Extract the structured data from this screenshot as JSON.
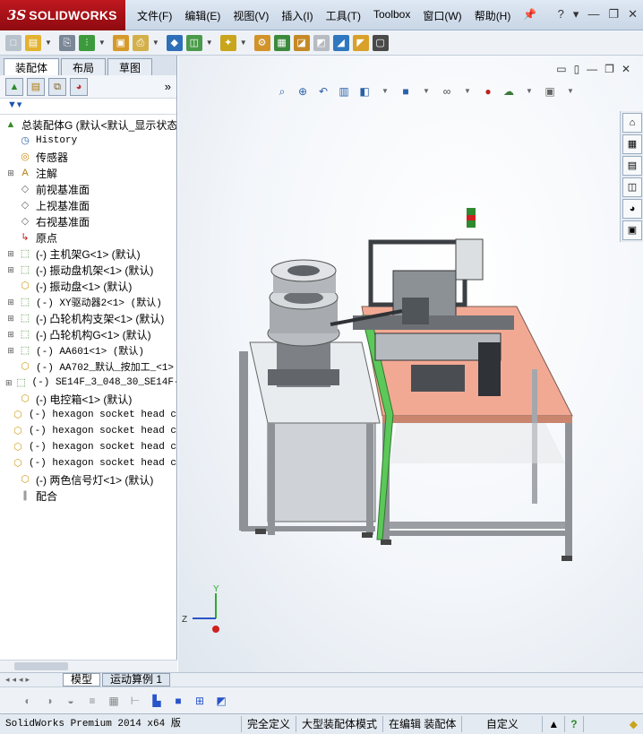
{
  "app": {
    "brand_prefix": "3S",
    "brand_name": "SOLIDWORKS"
  },
  "menu": [
    "文件(F)",
    "编辑(E)",
    "视图(V)",
    "插入(I)",
    "工具(T)",
    "Toolbox",
    "窗口(W)",
    "帮助(H)"
  ],
  "panel_tabs": [
    "装配体",
    "布局",
    "草图"
  ],
  "tree": [
    {
      "label": "总装配体G   (默认<默认_显示状态",
      "expand": "",
      "icon": "assembly-icon",
      "indent": 0
    },
    {
      "label": "History",
      "expand": "",
      "icon": "history-icon",
      "indent": 1,
      "mono": true
    },
    {
      "label": "传感器",
      "expand": "",
      "icon": "sensor-icon",
      "indent": 1
    },
    {
      "label": "注解",
      "expand": "+",
      "icon": "annotation-icon",
      "indent": 1
    },
    {
      "label": "前视基准面",
      "expand": "",
      "icon": "plane-icon",
      "indent": 1
    },
    {
      "label": "上视基准面",
      "expand": "",
      "icon": "plane-icon",
      "indent": 1
    },
    {
      "label": "右视基准面",
      "expand": "",
      "icon": "plane-icon",
      "indent": 1
    },
    {
      "label": "原点",
      "expand": "",
      "icon": "origin-icon",
      "indent": 1
    },
    {
      "label": "(-) 主机架G<1> (默认)",
      "expand": "+",
      "icon": "subassembly-icon",
      "indent": 1
    },
    {
      "label": "(-) 振动盘机架<1> (默认)",
      "expand": "+",
      "icon": "subassembly-icon",
      "indent": 1
    },
    {
      "label": "(-) 振动盘<1> (默认)",
      "expand": "",
      "icon": "part-icon",
      "indent": 1
    },
    {
      "label": "(-) XY驱动器2<1> (默认)",
      "expand": "+",
      "icon": "subassembly-icon",
      "indent": 1,
      "mono": true
    },
    {
      "label": "(-) 凸轮机构支架<1> (默认)",
      "expand": "+",
      "icon": "subassembly-icon",
      "indent": 1
    },
    {
      "label": "(-) 凸轮机构G<1> (默认)",
      "expand": "+",
      "icon": "subassembly-icon",
      "indent": 1
    },
    {
      "label": "(-) AA601<1> (默认)",
      "expand": "+",
      "icon": "subassembly-icon",
      "indent": 1,
      "mono": true
    },
    {
      "label": "(-) AA702_默认_按加工_<1>",
      "expand": "",
      "icon": "part-icon",
      "indent": 1,
      "mono": true
    },
    {
      "label": "(-) SE14F_3_048_30_SE14F-3",
      "expand": "+",
      "icon": "subassembly-icon",
      "indent": 1,
      "mono": true
    },
    {
      "label": "(-) 电控箱<1> (默认)",
      "expand": "",
      "icon": "part-icon",
      "indent": 1
    },
    {
      "label": "(-) hexagon socket head c",
      "expand": "",
      "icon": "part-icon",
      "indent": 1,
      "mono": true
    },
    {
      "label": "(-) hexagon socket head c",
      "expand": "",
      "icon": "part-icon",
      "indent": 1,
      "mono": true
    },
    {
      "label": "(-) hexagon socket head c",
      "expand": "",
      "icon": "part-icon",
      "indent": 1,
      "mono": true
    },
    {
      "label": "(-) hexagon socket head c",
      "expand": "",
      "icon": "part-icon",
      "indent": 1,
      "mono": true
    },
    {
      "label": "(-) 两色信号灯<1> (默认)",
      "expand": "",
      "icon": "part-icon",
      "indent": 1
    },
    {
      "label": "配合",
      "expand": "",
      "icon": "mates-icon",
      "indent": 1
    }
  ],
  "bottom_tabs": [
    "模型",
    "运动算例 1"
  ],
  "status": {
    "version": "SolidWorks Premium 2014 x64 版",
    "definition": "完全定义",
    "mode": "大型装配体模式",
    "editing": "在编辑 装配体",
    "custom": "自定义"
  },
  "triad": {
    "y": "Y",
    "z": "Z"
  },
  "colors": {
    "title_red": "#b5141b",
    "table_top": "#f2a994",
    "green_strip": "#5cc85a",
    "frame": "#8f9397"
  }
}
